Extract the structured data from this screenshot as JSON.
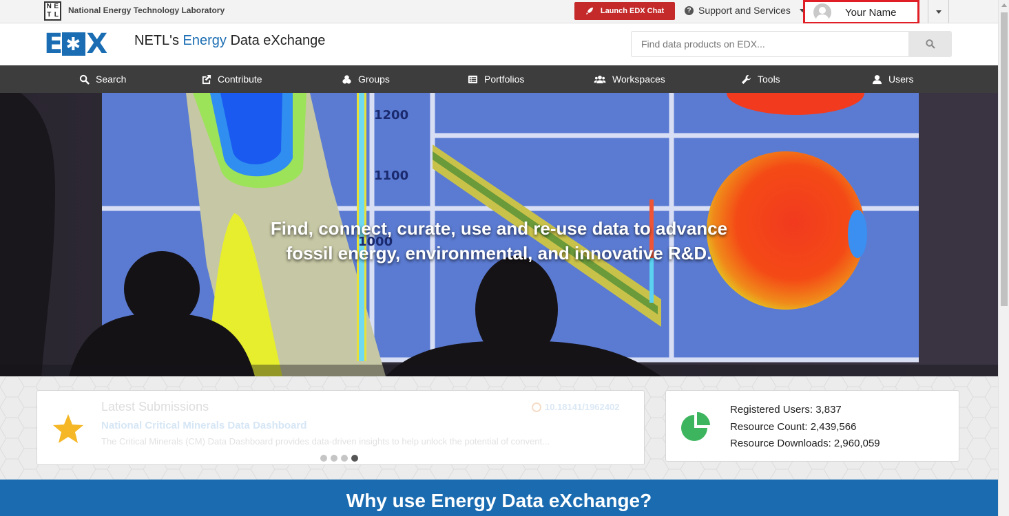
{
  "topbar": {
    "lab_logo_letters": [
      "N",
      "E",
      "T",
      "L"
    ],
    "lab_name": "National Energy Technology Laboratory",
    "launch_chat_label": "Launch EDX Chat",
    "support_label": "Support and Services",
    "user_name": "Your Name"
  },
  "header": {
    "logo_text": "EDX",
    "title_prefix": "NETL's",
    "title_highlight": "Energy",
    "title_suffix": "Data eXchange",
    "search_placeholder": "Find data products on EDX..."
  },
  "nav": {
    "items": [
      {
        "label": "Search",
        "icon": "search-icon"
      },
      {
        "label": "Contribute",
        "icon": "external-link-icon"
      },
      {
        "label": "Groups",
        "icon": "group-icon"
      },
      {
        "label": "Portfolios",
        "icon": "list-icon"
      },
      {
        "label": "Workspaces",
        "icon": "users-icon"
      },
      {
        "label": "Tools",
        "icon": "wrench-icon"
      },
      {
        "label": "Users",
        "icon": "user-icon"
      }
    ]
  },
  "hero": {
    "line1": "Find, connect, curate, use and re-use data to advance",
    "line2": "fossil energy, environmental, and innovative R&D.",
    "scale_labels": [
      "1200",
      "1100",
      "1000"
    ]
  },
  "latest": {
    "title": "Latest Submissions",
    "item_title": "National Critical Minerals Data Dashboard",
    "item_desc": "The Critical Minerals (CM) Data Dashboard provides data-driven insights to help unlock the potential of convent...",
    "doi": "10.18141/1962402",
    "active_slide": 4,
    "slide_count": 4
  },
  "stats": {
    "registered_users": "Registered Users: 3,837",
    "resource_count": "Resource Count: 2,439,566",
    "resource_downloads": "Resource Downloads: 2,960,059"
  },
  "why": {
    "title": "Why use Energy Data eXchange?"
  },
  "colors": {
    "brand_blue": "#1a6db3",
    "launch_red": "#c42a2a",
    "nav_dark": "#3d3d3d",
    "highlight_red": "#e01e26",
    "stats_green": "#3cb55e",
    "star_gold": "#f5b726"
  }
}
